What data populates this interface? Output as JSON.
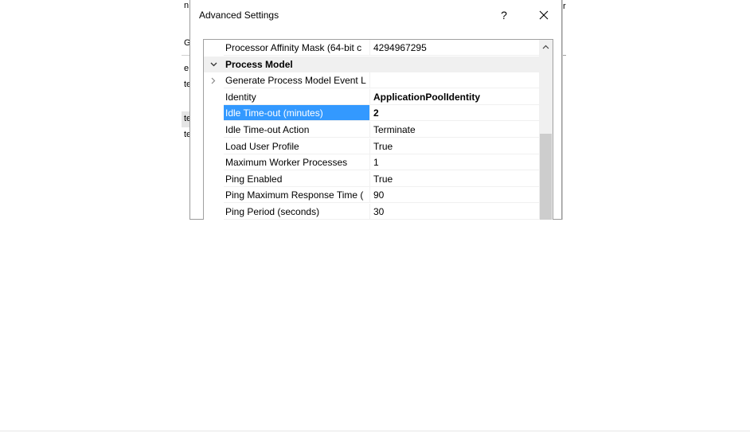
{
  "background_window": {
    "left_fragments": [
      "n",
      "Gr",
      "e",
      "te",
      "te",
      "te"
    ],
    "right_fragment": "r"
  },
  "dialog": {
    "title": "Advanced Settings",
    "help_label": "?",
    "close_label": "✕"
  },
  "grid": {
    "rows": [
      {
        "name": "Processor Affinity Mask (64-bit c",
        "value": "4294967295",
        "type": "prop"
      },
      {
        "name": "Process Model",
        "value": "",
        "type": "category",
        "expander": "collapse"
      },
      {
        "name": "Generate Process Model Event L",
        "value": "",
        "type": "prop",
        "expander": "expand"
      },
      {
        "name": "Identity",
        "value": "ApplicationPoolIdentity",
        "type": "prop",
        "bold_value": true
      },
      {
        "name": "Idle Time-out (minutes)",
        "value": "2",
        "type": "prop",
        "selected": true,
        "bold_value": true
      },
      {
        "name": "Idle Time-out Action",
        "value": "Terminate",
        "type": "prop"
      },
      {
        "name": "Load User Profile",
        "value": "True",
        "type": "prop"
      },
      {
        "name": "Maximum Worker Processes",
        "value": "1",
        "type": "prop"
      },
      {
        "name": "Ping Enabled",
        "value": "True",
        "type": "prop"
      },
      {
        "name": "Ping Maximum Response Time (",
        "value": "90",
        "type": "prop"
      },
      {
        "name": "Ping Period (seconds)",
        "value": "30",
        "type": "prop"
      }
    ]
  },
  "colors": {
    "selection": "#3399ff",
    "category_bg": "#f0f0f0",
    "scroll_thumb": "#cdcdcd"
  }
}
